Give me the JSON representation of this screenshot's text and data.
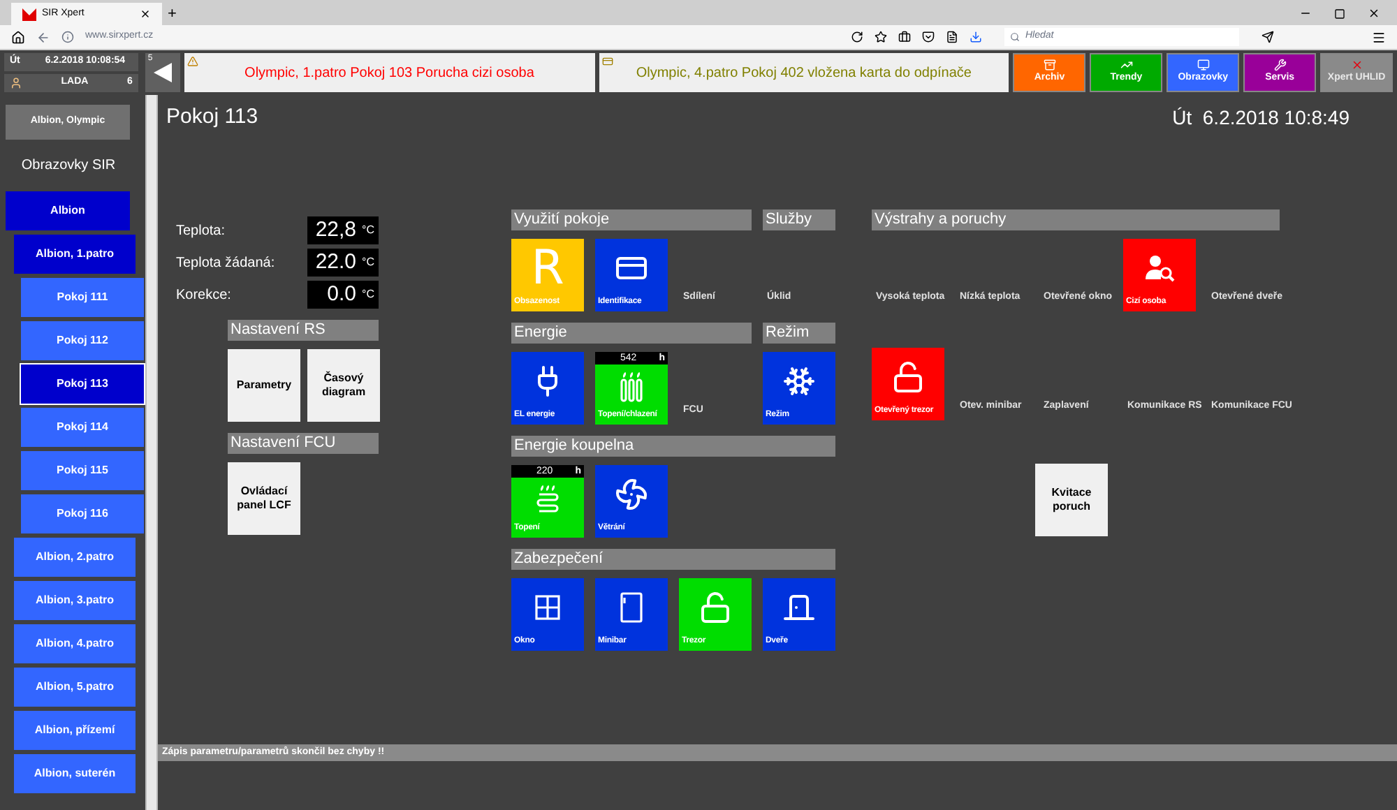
{
  "browser": {
    "tab_title": "SIR Xpert",
    "url": "www.sirxpert.cz",
    "search_placeholder": "Hledat",
    "new_tab": "+"
  },
  "topbar": {
    "day": "Út",
    "datetime": "6.2.2018 10:08:54",
    "user": "LADA",
    "user_count": "6",
    "back_count": "5",
    "alerts": [
      {
        "text": "Olympic, 1.patro Pokoj 103 Porucha cizi osoba",
        "color": "#ff0000"
      },
      {
        "text": "Olympic, 4.patro Pokoj 402 vložena karta do odpínače",
        "color": "#808000"
      }
    ],
    "buttons": [
      {
        "label": "Archiv",
        "color": "#ff6600",
        "disabled": false
      },
      {
        "label": "Trendy",
        "color": "#00aa00",
        "disabled": false
      },
      {
        "label": "Obrazovky",
        "color": "#3366ff",
        "disabled": false
      },
      {
        "label": "Servis",
        "color": "#990099",
        "disabled": false
      },
      {
        "label": "Xpert UHLID",
        "color": "#8a8a8a",
        "disabled": true
      }
    ]
  },
  "sidebar": {
    "site_button": "Albion, Olympic",
    "heading": "Obrazovky SIR",
    "items": [
      {
        "label": "Albion",
        "selected": false,
        "expanded": true,
        "children": [
          {
            "label": "Albion, 1.patro",
            "selected": false,
            "expanded": true,
            "children": [
              {
                "label": "Pokoj 111",
                "selected": false
              },
              {
                "label": "Pokoj 112",
                "selected": false
              },
              {
                "label": "Pokoj 113",
                "selected": true
              },
              {
                "label": "Pokoj 114",
                "selected": false
              },
              {
                "label": "Pokoj 115",
                "selected": false
              },
              {
                "label": "Pokoj 116",
                "selected": false
              }
            ]
          },
          {
            "label": "Albion, 2.patro",
            "selected": false,
            "expanded": false
          },
          {
            "label": "Albion, 3.patro",
            "selected": false,
            "expanded": false
          },
          {
            "label": "Albion, 4.patro",
            "selected": false,
            "expanded": false
          },
          {
            "label": "Albion, 5.patro",
            "selected": false,
            "expanded": false
          },
          {
            "label": "Albion, přízemí",
            "selected": false,
            "expanded": false
          },
          {
            "label": "Albion, suterén",
            "selected": false,
            "expanded": false
          }
        ]
      }
    ]
  },
  "room": {
    "title": "Pokoj 113",
    "day": "Út",
    "datetime": "6.2.2018 10:8:49"
  },
  "readings": [
    {
      "label": "Teplota:",
      "value": "22,8",
      "unit": "°C"
    },
    {
      "label": "Teplota žádaná:",
      "value": "22.0",
      "unit": "°C"
    },
    {
      "label": "Korekce:",
      "value": "0.0",
      "unit": "°C"
    }
  ],
  "left_sections": [
    {
      "title": "Nastavení RS",
      "tiles": [
        {
          "kind": "button",
          "label": "Parametry"
        },
        {
          "kind": "button",
          "label": "Časový diagram"
        }
      ]
    },
    {
      "title": "Nastavení FCU",
      "tiles": [
        {
          "kind": "button",
          "label": "Ovládací panel LCF"
        }
      ]
    }
  ],
  "middle_rows": [
    [
      {
        "title": "Využití pokoje",
        "tiles": [
          {
            "kind": "icon",
            "label": "Obsazenost",
            "color": "#ffc800",
            "glyph": "R"
          },
          {
            "kind": "icon",
            "label": "Identifikace",
            "color": "#0033dd"
          },
          {
            "kind": "empty",
            "label": "Sdílení"
          }
        ]
      },
      {
        "title": "Služby",
        "tiles": [
          {
            "kind": "empty",
            "label": "Úklid"
          }
        ]
      }
    ],
    [
      {
        "title": "Energie",
        "tiles": [
          {
            "kind": "icon",
            "label": "EL energie",
            "color": "#0033dd"
          },
          {
            "kind": "icon",
            "label": "Topení/chlazení",
            "color": "#00dd00",
            "counter": {
              "value": "542",
              "unit": "h"
            }
          },
          {
            "kind": "empty",
            "label": "FCU"
          }
        ]
      },
      {
        "title": "Režim",
        "tiles": [
          {
            "kind": "icon",
            "label": "Režim",
            "color": "#0033dd"
          }
        ]
      }
    ],
    [
      {
        "title": "Energie koupelna",
        "tiles": [
          {
            "kind": "icon",
            "label": "Topení",
            "color": "#00dd00",
            "counter": {
              "value": "220",
              "unit": "h"
            }
          },
          {
            "kind": "icon",
            "label": "Větrání",
            "color": "#0033dd"
          }
        ]
      }
    ],
    [
      {
        "title": "Zabezpečení",
        "tiles": [
          {
            "kind": "icon",
            "label": "Okno",
            "color": "#0033dd"
          },
          {
            "kind": "icon",
            "label": "Minibar",
            "color": "#0033dd"
          },
          {
            "kind": "icon",
            "label": "Trezor",
            "color": "#00dd00"
          },
          {
            "kind": "icon",
            "label": "Dveře",
            "color": "#0033dd"
          }
        ]
      }
    ]
  ],
  "warnings": {
    "title": "Výstrahy a poruchy",
    "tiles": [
      {
        "kind": "empty",
        "label": "Vysoká teplota"
      },
      {
        "kind": "empty",
        "label": "Nízká teplota"
      },
      {
        "kind": "empty",
        "label": "Otevřené okno"
      },
      {
        "kind": "icon",
        "label": "Cizí osoba",
        "color": "#ff0000"
      },
      {
        "kind": "empty",
        "label": "Otevřené dveře"
      },
      {
        "kind": "icon",
        "label": "Otevřený trezor",
        "color": "#ff0000"
      },
      {
        "kind": "empty",
        "label": "Otev. minibar"
      },
      {
        "kind": "empty",
        "label": "Zaplavení"
      },
      {
        "kind": "empty",
        "label": "Komunikace RS"
      },
      {
        "kind": "empty",
        "label": "Komunikace FCU"
      }
    ],
    "actions": [
      {
        "kind": "button",
        "label": "Kvitace poruch"
      }
    ]
  },
  "status_bar": "Zápis parametru/parametrů skončil bez chyby !!"
}
